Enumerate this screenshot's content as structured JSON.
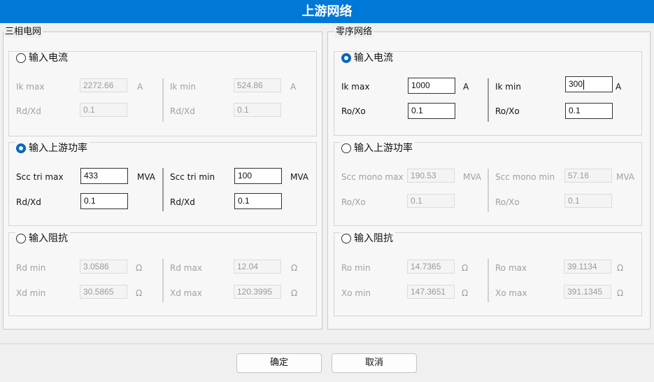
{
  "title": "上游网络",
  "three_phase": {
    "legend": "三相电网",
    "current": {
      "option": "输入电流",
      "ik_max_label": "Ik max",
      "ik_max": "2272.66",
      "ik_max_unit": "A",
      "ik_min_label": "Ik min",
      "ik_min": "524.86",
      "ik_min_unit": "A",
      "rdxd_left_label": "Rd/Xd",
      "rdxd_left": "0.1",
      "rdxd_right_label": "Rd/Xd",
      "rdxd_right": "0.1"
    },
    "power": {
      "option": "输入上游功率",
      "scc_max_label": "Scc tri max",
      "scc_max": "433",
      "scc_max_unit": "MVA",
      "scc_min_label": "Scc tri min",
      "scc_min": "100",
      "scc_min_unit": "MVA",
      "rdxd_left_label": "Rd/Xd",
      "rdxd_left": "0.1",
      "rdxd_right_label": "Rd/Xd",
      "rdxd_right": "0.1"
    },
    "impedance": {
      "option": "输入阻抗",
      "rd_min_label": "Rd min",
      "rd_min": "3.0586",
      "rd_min_unit": "Ω",
      "rd_max_label": "Rd max",
      "rd_max": "12.04",
      "rd_max_unit": "Ω",
      "xd_min_label": "Xd min",
      "xd_min": "30.5865",
      "xd_min_unit": "Ω",
      "xd_max_label": "Xd max",
      "xd_max": "120.3995",
      "xd_max_unit": "Ω"
    }
  },
  "zero_seq": {
    "legend": "零序网络",
    "current": {
      "option": "输入电流",
      "ik_max_label": "Ik max",
      "ik_max": "1000",
      "ik_max_unit": "A",
      "ik_min_label": "Ik min",
      "ik_min": "300",
      "ik_min_unit": "A",
      "roxo_left_label": "Ro/Xo",
      "roxo_left": "0.1",
      "roxo_right_label": "Ro/Xo",
      "roxo_right": "0.1"
    },
    "power": {
      "option": "输入上游功率",
      "scc_max_label": "Scc mono max",
      "scc_max": "190.53",
      "scc_max_unit": "MVA",
      "scc_min_label": "Scc mono min",
      "scc_min": "57.16",
      "scc_min_unit": "MVA",
      "roxo_left_label": "Ro/Xo",
      "roxo_left": "0.1",
      "roxo_right_label": "Ro/Xo",
      "roxo_right": "0.1"
    },
    "impedance": {
      "option": "输入阻抗",
      "ro_min_label": "Ro min",
      "ro_min": "14.7365",
      "ro_min_unit": "Ω",
      "ro_max_label": "Ro max",
      "ro_max": "39.1134",
      "ro_max_unit": "Ω",
      "xo_min_label": "Xo min",
      "xo_min": "147.3651",
      "xo_min_unit": "Ω",
      "xo_max_label": "Xo max",
      "xo_max": "391.1345",
      "xo_max_unit": "Ω"
    }
  },
  "buttons": {
    "ok": "确定",
    "cancel": "取消"
  },
  "colors": {
    "titlebar": "#0078d7",
    "radio_selected": "#0067c0"
  }
}
